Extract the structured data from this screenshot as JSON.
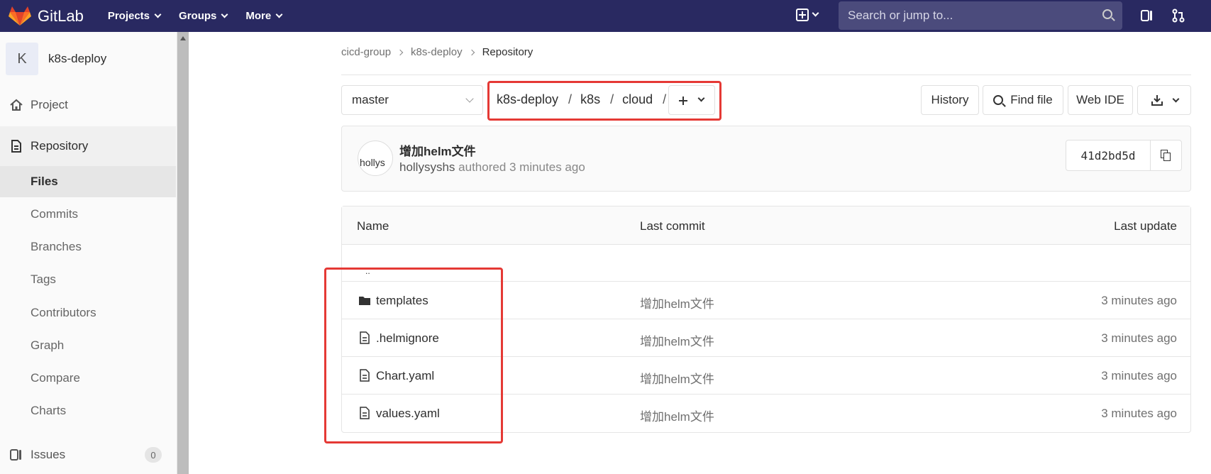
{
  "topnav": {
    "brand": "GitLab",
    "menu": [
      "Projects",
      "Groups",
      "More"
    ],
    "search_placeholder": "Search or jump to..."
  },
  "sidebar": {
    "avatar_letter": "K",
    "project_name": "k8s-deploy",
    "project_label": "Project",
    "repository_label": "Repository",
    "sub_items": [
      "Files",
      "Commits",
      "Branches",
      "Tags",
      "Contributors",
      "Graph",
      "Compare",
      "Charts"
    ],
    "active_sub": "Files",
    "issues_label": "Issues",
    "issues_count": "0"
  },
  "breadcrumb": [
    "cicd-group",
    "k8s-deploy",
    "Repository"
  ],
  "toolbar": {
    "branch": "master",
    "path": [
      "k8s-deploy",
      "k8s",
      "cloud"
    ],
    "history_label": "History",
    "find_file_label": "Find file",
    "web_ide_label": "Web IDE"
  },
  "commit": {
    "avatar_alt": "hollys",
    "title": "增加helm文件",
    "author": "hollysyshs",
    "meta": "authored 3 minutes ago",
    "sha": "41d2bd5d"
  },
  "table": {
    "headers": [
      "Name",
      "Last commit",
      "Last update"
    ],
    "updir": "..",
    "rows": [
      {
        "name": "templates",
        "type": "folder",
        "last_commit": "增加helm文件",
        "last_update": "3 minutes ago"
      },
      {
        "name": ".helmignore",
        "type": "file",
        "last_commit": "增加helm文件",
        "last_update": "3 minutes ago"
      },
      {
        "name": "Chart.yaml",
        "type": "file",
        "last_commit": "增加helm文件",
        "last_update": "3 minutes ago"
      },
      {
        "name": "values.yaml",
        "type": "file",
        "last_commit": "增加helm文件",
        "last_update": "3 minutes ago"
      }
    ]
  },
  "colors": {
    "nav_bg": "#292961",
    "highlight_border": "#e53935"
  }
}
